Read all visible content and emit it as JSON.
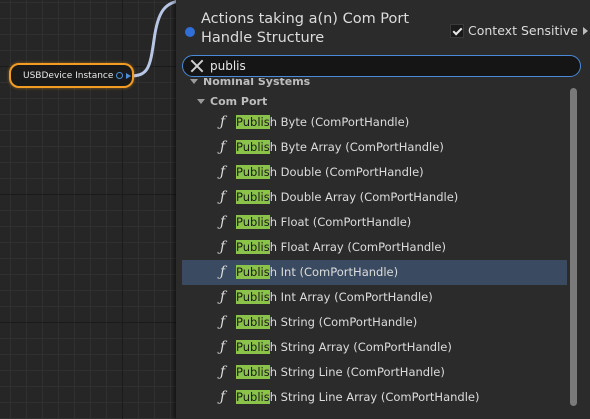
{
  "node": {
    "title": "USBDevice Instance"
  },
  "menu": {
    "title": "Actions taking a(n) Com Port Handle Structure",
    "context_sensitive": {
      "label": "Context Sensitive",
      "checked": true
    }
  },
  "search": {
    "value": "publis",
    "highlight": "Publis"
  },
  "categories": {
    "top": "Nominal Systems",
    "sub": "Com Port"
  },
  "items": [
    {
      "rest": "h Byte (ComPortHandle)",
      "selected": false
    },
    {
      "rest": "h Byte Array (ComPortHandle)",
      "selected": false
    },
    {
      "rest": "h Double (ComPortHandle)",
      "selected": false
    },
    {
      "rest": "h Double Array (ComPortHandle)",
      "selected": false
    },
    {
      "rest": "h Float (ComPortHandle)",
      "selected": false
    },
    {
      "rest": "h Float Array (ComPortHandle)",
      "selected": false
    },
    {
      "rest": "h Int (ComPortHandle)",
      "selected": true
    },
    {
      "rest": "h Int Array (ComPortHandle)",
      "selected": false
    },
    {
      "rest": "h String (ComPortHandle)",
      "selected": false
    },
    {
      "rest": "h String Array (ComPortHandle)",
      "selected": false
    },
    {
      "rest": "h String Line (ComPortHandle)",
      "selected": false
    },
    {
      "rest": "h String Line Array (ComPortHandle)",
      "selected": false
    }
  ],
  "colors": {
    "accent": "#4a8ad8",
    "highlight": "#8bc34a",
    "selection": "#3a4a60",
    "node_border": "#f39c23"
  }
}
